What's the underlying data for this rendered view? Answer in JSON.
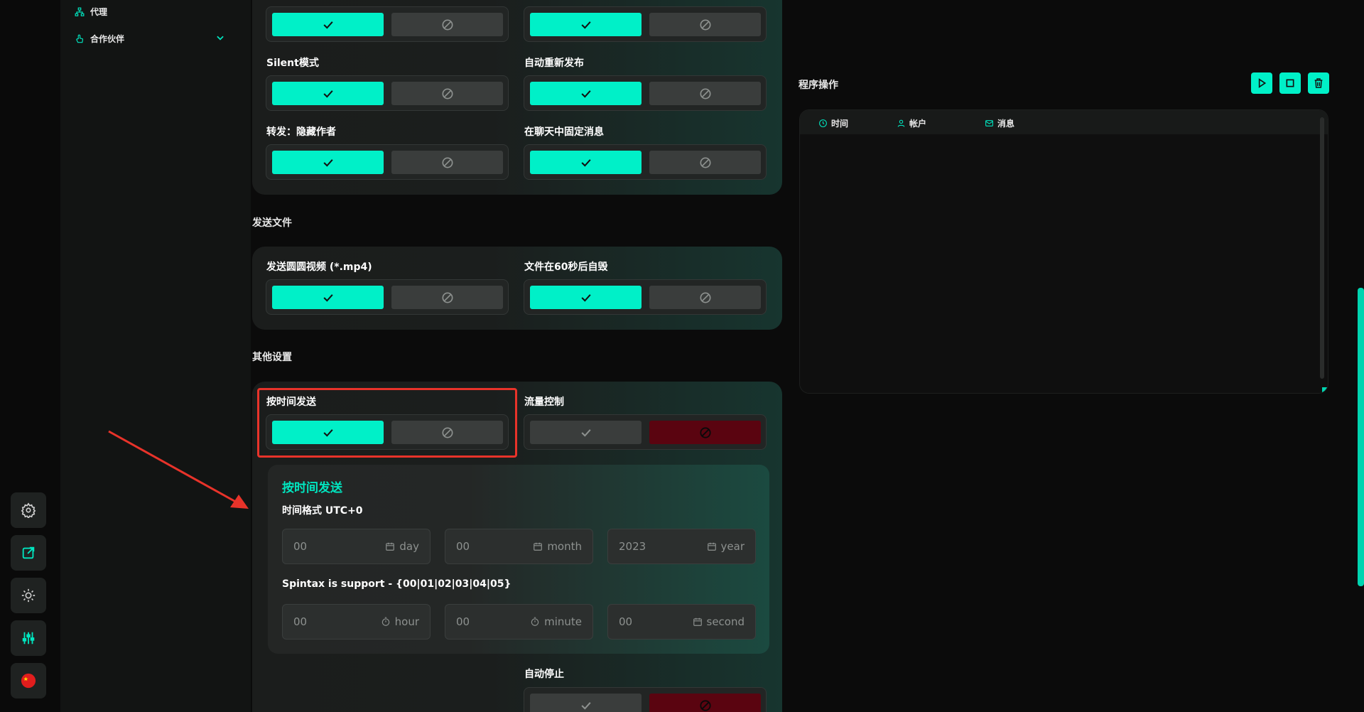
{
  "sidebar": {
    "items": [
      {
        "label": "代理"
      },
      {
        "label": "合作伙伴"
      }
    ]
  },
  "sections": {
    "send_files": "发送文件",
    "other_settings": "其他设置"
  },
  "options": {
    "silent_mode": "Silent模式",
    "auto_republish": "自动重新发布",
    "forward_hide_author": "转发：隐藏作者",
    "pin_message": "在聊天中固定消息",
    "send_round_video": "发送圆圆视频 (*.mp4)",
    "self_destruct": "文件在60秒后自毁",
    "send_by_time": "按时间发送",
    "flow_control": "流量控制",
    "auto_stop": "自动停止"
  },
  "schedule": {
    "title": "按时间发送",
    "time_format": "时间格式 UTC+0",
    "spintax": "Spintax is support - {00|01|02|03|04|05}",
    "fields": [
      {
        "value": "00",
        "unit": "day"
      },
      {
        "value": "00",
        "unit": "month"
      },
      {
        "value": "2023",
        "unit": "year"
      },
      {
        "value": "00",
        "unit": "hour"
      },
      {
        "value": "00",
        "unit": "minute"
      },
      {
        "value": "00",
        "unit": "second"
      }
    ]
  },
  "right": {
    "title": "程序操作",
    "log_columns": [
      "时间",
      "帐户",
      "消息"
    ]
  },
  "colors": {
    "accent": "#00f0c8",
    "danger": "#5a0410",
    "highlight_border": "#e8332a"
  }
}
